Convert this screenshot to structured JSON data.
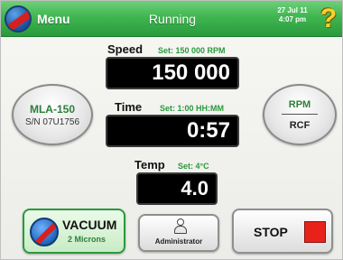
{
  "header": {
    "menu_label": "Menu",
    "status": "Running",
    "date": "27 Jul 11",
    "time": "4:07 pm",
    "help_symbol": "?"
  },
  "speed": {
    "label": "Speed",
    "setpoint": "Set: 150 000 RPM",
    "value": "150 000"
  },
  "time": {
    "label": "Time",
    "setpoint": "Set: 1:00 HH:MM",
    "value": "0:57"
  },
  "temp": {
    "label": "Temp",
    "setpoint": "Set: 4°C",
    "value": "4.0"
  },
  "rotor": {
    "name": "MLA-150",
    "serial": "S/N 07U1756"
  },
  "units_toggle": {
    "top": "RPM",
    "bottom": "RCF"
  },
  "vacuum": {
    "title": "VACUUM",
    "value": "2 Microns"
  },
  "admin": {
    "label": "Administrator"
  },
  "stop": {
    "label": "STOP"
  },
  "colors": {
    "accent_green": "#3fb650",
    "stop_red": "#e8221a",
    "help_yellow": "#f6d32a"
  }
}
